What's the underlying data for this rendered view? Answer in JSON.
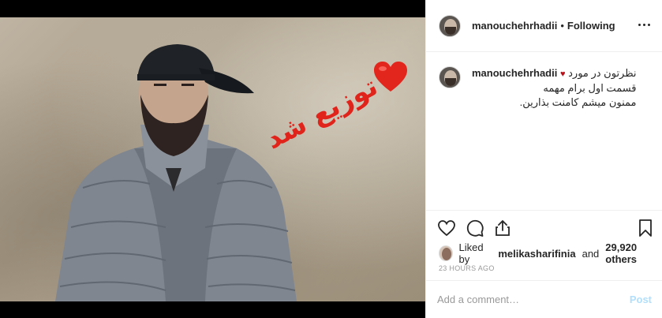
{
  "post": {
    "overlay_text": "توزیع شد",
    "image_alt": "Man with beard in gray puffer jacket and cap"
  },
  "header": {
    "username": "manouchehrhadii",
    "separator": "•",
    "follow_status": "Following"
  },
  "caption": {
    "username": "manouchehrhadii",
    "line1": "نظرتون در مورد",
    "line2": "قسمت اول برام مهمه",
    "line3": "ممنون میشم کامنت بذارین."
  },
  "likes": {
    "prefix": "Liked by",
    "liker": "melikasharifinia",
    "connector": "and",
    "others": "29,920 others"
  },
  "timestamp": "23 HOURS AGO",
  "comment": {
    "placeholder": "Add a comment…",
    "post_label": "Post"
  },
  "colors": {
    "overlay_red": "#e0241c",
    "post_disabled_blue": "#b2dffc",
    "text": "#262626"
  },
  "icons": [
    "more-icon",
    "heart-icon",
    "comment-icon",
    "share-icon",
    "bookmark-icon"
  ]
}
